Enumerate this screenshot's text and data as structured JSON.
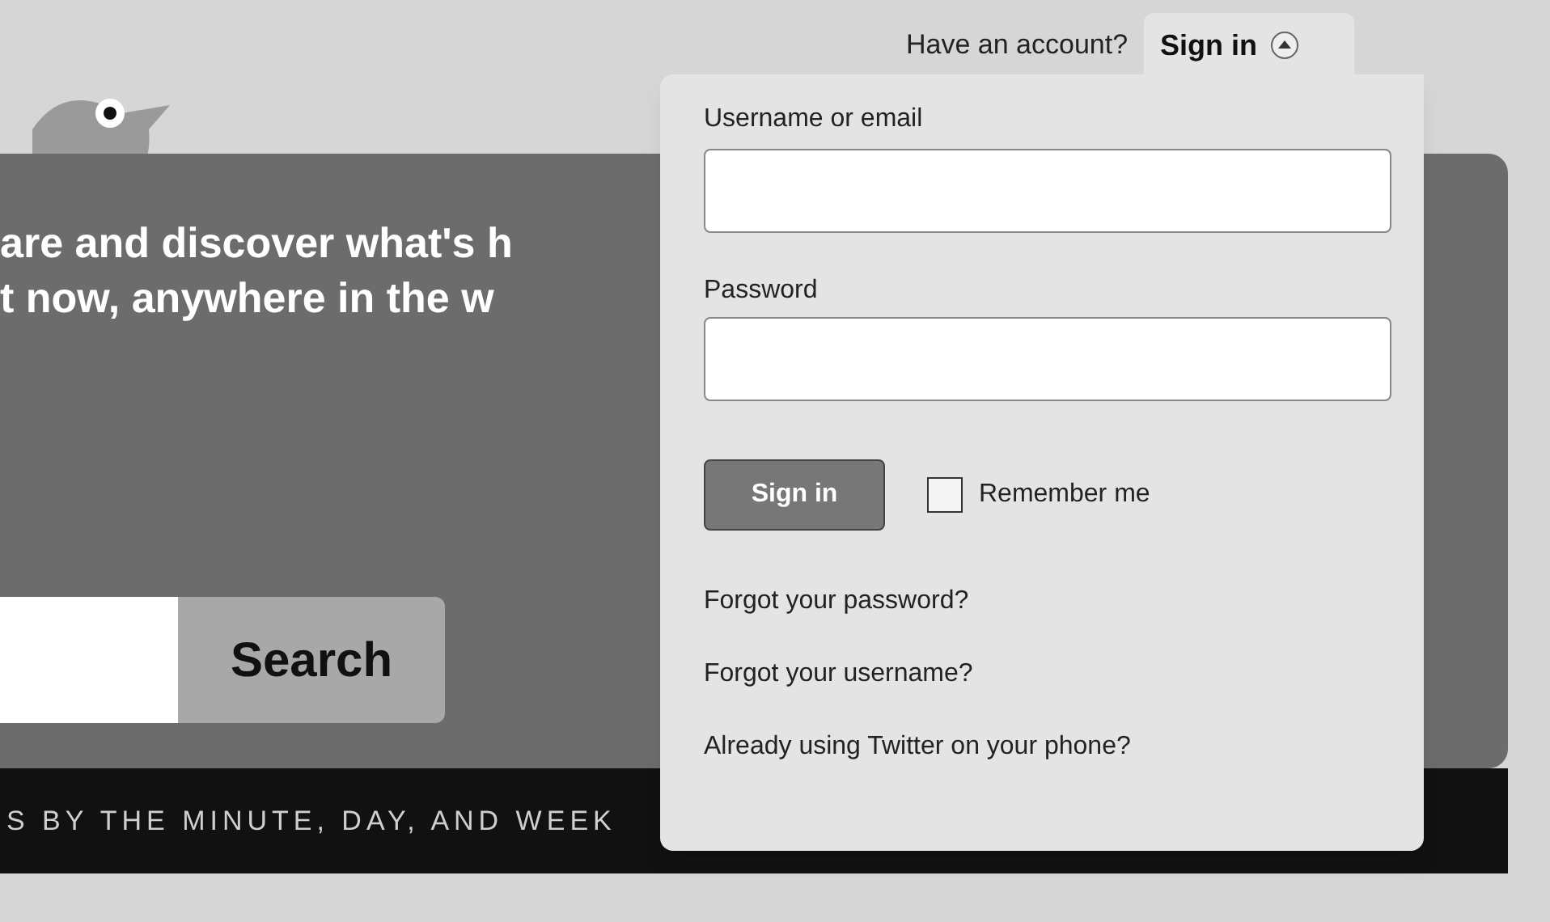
{
  "hero": {
    "headline_lines": [
      "are and discover what's h",
      "t now, anywhere in the w"
    ],
    "search_button": "Search",
    "ticker": "S BY THE MINUTE, DAY, AND WEEK"
  },
  "account_bar": {
    "prompt": "Have an account?",
    "sign_in_toggle": "Sign in",
    "expanded": true
  },
  "sign_in_form": {
    "username_label": "Username or email",
    "password_label": "Password",
    "submit": "Sign in",
    "remember_me": {
      "label": "Remember me",
      "checked": false
    },
    "links": [
      "Forgot your password?",
      "Forgot your username?",
      "Already using Twitter on your phone?"
    ]
  }
}
